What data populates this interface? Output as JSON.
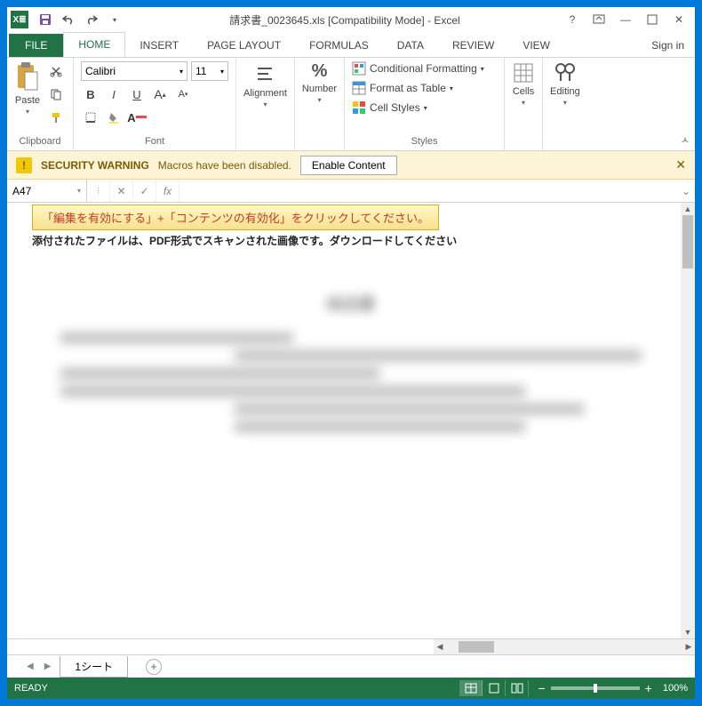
{
  "title": "請求書_0023645.xls  [Compatibility Mode] - Excel",
  "qat": {
    "save": "save",
    "undo": "undo",
    "redo": "redo"
  },
  "window": {
    "help": "?",
    "ribbonopts": "▭",
    "min": "—",
    "max": "☐",
    "close": "✕"
  },
  "tabs": {
    "file": "FILE",
    "items": [
      "HOME",
      "INSERT",
      "PAGE LAYOUT",
      "FORMULAS",
      "DATA",
      "REVIEW",
      "VIEW"
    ],
    "active": 0,
    "signin": "Sign in"
  },
  "ribbon": {
    "clipboard": {
      "label": "Clipboard",
      "paste": "Paste"
    },
    "font": {
      "label": "Font",
      "name": "Calibri",
      "size": "11",
      "bold": "B",
      "italic": "I",
      "underline": "U"
    },
    "alignment": {
      "label": "Alignment"
    },
    "number": {
      "label": "Number",
      "percent": "%"
    },
    "styles": {
      "label": "Styles",
      "cond": "Conditional Formatting",
      "table": "Format as Table",
      "cell": "Cell Styles"
    },
    "cells": {
      "label": "Cells"
    },
    "editing": {
      "label": "Editing"
    }
  },
  "warning": {
    "title": "SECURITY WARNING",
    "msg": "Macros have been disabled.",
    "button": "Enable Content"
  },
  "formula": {
    "cellref": "A47",
    "fx": "fx",
    "value": ""
  },
  "sheet": {
    "yellow_text": "「編集を有効にする」+「コンテンツの有効化」をクリックしてください。",
    "line2": "添付されたファイルは、PDF形式でスキャンされた画像です。ダウンロードしてください",
    "doc_title": "納品書"
  },
  "sheettabs": {
    "active": "1シート",
    "add": "+"
  },
  "status": {
    "ready": "READY",
    "zoom": "100%",
    "minus": "−",
    "plus": "+"
  }
}
